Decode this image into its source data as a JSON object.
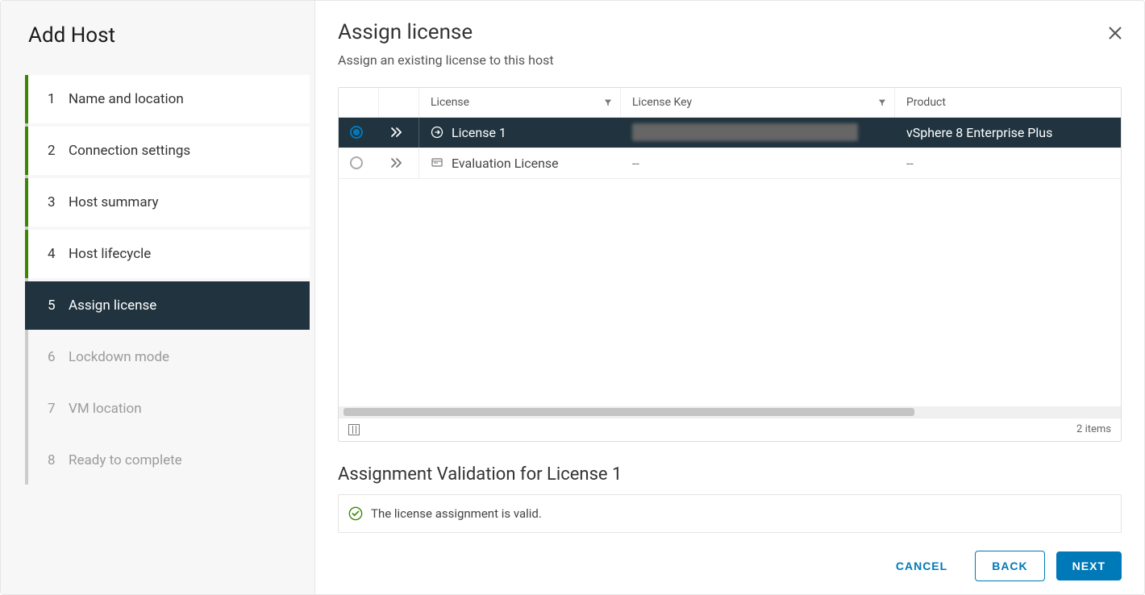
{
  "sidebar": {
    "title": "Add Host",
    "steps": [
      {
        "num": "1",
        "label": "Name and location",
        "state": "completed"
      },
      {
        "num": "2",
        "label": "Connection settings",
        "state": "completed"
      },
      {
        "num": "3",
        "label": "Host summary",
        "state": "completed"
      },
      {
        "num": "4",
        "label": "Host lifecycle",
        "state": "completed"
      },
      {
        "num": "5",
        "label": "Assign license",
        "state": "active"
      },
      {
        "num": "6",
        "label": "Lockdown mode",
        "state": "future"
      },
      {
        "num": "7",
        "label": "VM location",
        "state": "future"
      },
      {
        "num": "8",
        "label": "Ready to complete",
        "state": "future"
      }
    ]
  },
  "main": {
    "title": "Assign license",
    "subtitle": "Assign an existing license to this host"
  },
  "table": {
    "headers": {
      "license": "License",
      "license_key": "License Key",
      "product": "Product"
    },
    "rows": [
      {
        "selected": true,
        "name": "License 1",
        "key_redacted": true,
        "product": "vSphere 8 Enterprise Plus"
      },
      {
        "selected": false,
        "name": "Evaluation License",
        "key": "--",
        "product": "--"
      }
    ],
    "footer_count": "2 items"
  },
  "validation": {
    "title": "Assignment Validation for License 1",
    "message": "The license assignment is valid."
  },
  "footer": {
    "cancel": "CANCEL",
    "back": "BACK",
    "next": "NEXT"
  }
}
